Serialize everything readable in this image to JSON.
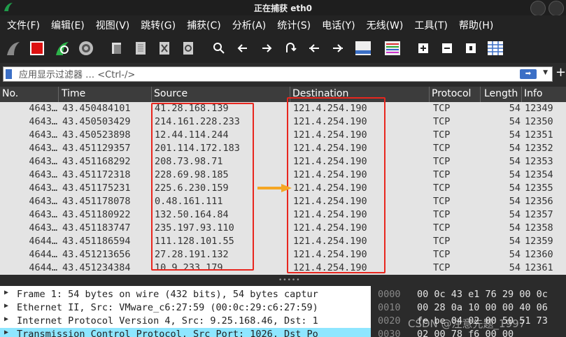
{
  "window": {
    "title": "正在捕获 eth0"
  },
  "menu": [
    "文件(F)",
    "编辑(E)",
    "视图(V)",
    "跳转(G)",
    "捕获(C)",
    "分析(A)",
    "统计(S)",
    "电话(Y)",
    "无线(W)",
    "工具(T)",
    "帮助(H)"
  ],
  "filter": {
    "placeholder": "应用显示过滤器 … <Ctrl-/>",
    "value": ""
  },
  "columns": {
    "no": "No.",
    "time": "Time",
    "source": "Source",
    "destination": "Destination",
    "protocol": "Protocol",
    "length": "Length",
    "info": "Info"
  },
  "packets": [
    {
      "no": "4643…",
      "time": "43.450484101",
      "source": "41.28.168.139",
      "destination": "121.4.254.190",
      "protocol": "TCP",
      "length": "54",
      "info": "12349"
    },
    {
      "no": "4643…",
      "time": "43.450503429",
      "source": "214.161.228.233",
      "destination": "121.4.254.190",
      "protocol": "TCP",
      "length": "54",
      "info": "12350"
    },
    {
      "no": "4643…",
      "time": "43.450523898",
      "source": "12.44.114.244",
      "destination": "121.4.254.190",
      "protocol": "TCP",
      "length": "54",
      "info": "12351"
    },
    {
      "no": "4643…",
      "time": "43.451129357",
      "source": "201.114.172.183",
      "destination": "121.4.254.190",
      "protocol": "TCP",
      "length": "54",
      "info": "12352"
    },
    {
      "no": "4643…",
      "time": "43.451168292",
      "source": "208.73.98.71",
      "destination": "121.4.254.190",
      "protocol": "TCP",
      "length": "54",
      "info": "12353"
    },
    {
      "no": "4643…",
      "time": "43.451172318",
      "source": "228.69.98.185",
      "destination": "121.4.254.190",
      "protocol": "TCP",
      "length": "54",
      "info": "12354"
    },
    {
      "no": "4643…",
      "time": "43.451175231",
      "source": "225.6.230.159",
      "destination": "121.4.254.190",
      "protocol": "TCP",
      "length": "54",
      "info": "12355"
    },
    {
      "no": "4643…",
      "time": "43.451178078",
      "source": "0.48.161.111",
      "destination": "121.4.254.190",
      "protocol": "TCP",
      "length": "54",
      "info": "12356"
    },
    {
      "no": "4643…",
      "time": "43.451180922",
      "source": "132.50.164.84",
      "destination": "121.4.254.190",
      "protocol": "TCP",
      "length": "54",
      "info": "12357"
    },
    {
      "no": "4643…",
      "time": "43.451183747",
      "source": "235.197.93.110",
      "destination": "121.4.254.190",
      "protocol": "TCP",
      "length": "54",
      "info": "12358"
    },
    {
      "no": "4644…",
      "time": "43.451186594",
      "source": "111.128.101.55",
      "destination": "121.4.254.190",
      "protocol": "TCP",
      "length": "54",
      "info": "12359"
    },
    {
      "no": "4644…",
      "time": "43.451213656",
      "source": "27.28.191.132",
      "destination": "121.4.254.190",
      "protocol": "TCP",
      "length": "54",
      "info": "12360"
    },
    {
      "no": "4644…",
      "time": "43.451234384",
      "source": "10.9.233.179",
      "destination": "121.4.254.190",
      "protocol": "TCP",
      "length": "54",
      "info": "12361"
    }
  ],
  "details": [
    "Frame 1: 54 bytes on wire (432 bits), 54 bytes captur",
    "Ethernet II, Src: VMware_c6:27:59 (00:0c:29:c6:27:59)",
    "Internet Protocol Version 4, Src: 9.25.168.46, Dst: 1",
    "Transmission Control Protocol, Src Port: 1026, Dst Po"
  ],
  "hex": [
    {
      "offset": "0000",
      "bytes": "00 0c 43 e1 76 29 00 0c"
    },
    {
      "offset": "0010",
      "bytes": "00 28 0a 10 00 00 40 06"
    },
    {
      "offset": "0020",
      "bytes": "fe be 04 02 00 50 51 73"
    },
    {
      "offset": "0030",
      "bytes": "02 00 78 f6 00 00"
    }
  ],
  "watermark": "CSDN @注意先题_1997",
  "colors": {
    "highlight_box": "#e8261e",
    "arrow": "#f5a623",
    "selected_row": "#8ee6ff"
  }
}
